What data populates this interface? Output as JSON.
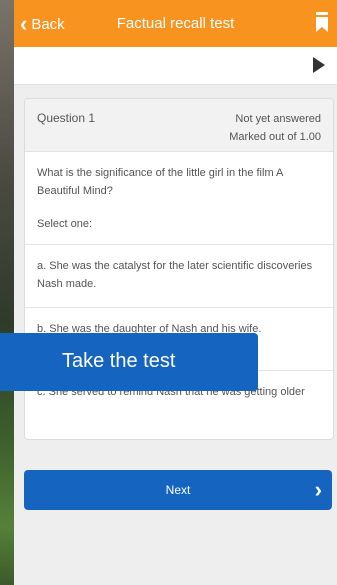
{
  "header": {
    "back_label": "Back",
    "title": "Factual recall test",
    "bookmark_icon": "bookmark-icon"
  },
  "toolbar": {
    "play_icon": "play-icon"
  },
  "question": {
    "number": "Question 1",
    "status": "Not yet answered",
    "marks": "Marked out of 1.00",
    "text": "What is the significance of the little girl in the film A Beautiful Mind?",
    "instruction": "Select one:",
    "options": [
      "a. She was the catalyst for the later scientific discoveries Nash made.",
      "b. She was the daughter of Nash and his wife.",
      "c. She served to remind Nash that he was getting older"
    ]
  },
  "next_button": {
    "label": "Next"
  },
  "overlay": {
    "label": "Take the test"
  },
  "colors": {
    "accent": "#f7931e",
    "primary": "#1565c0"
  }
}
